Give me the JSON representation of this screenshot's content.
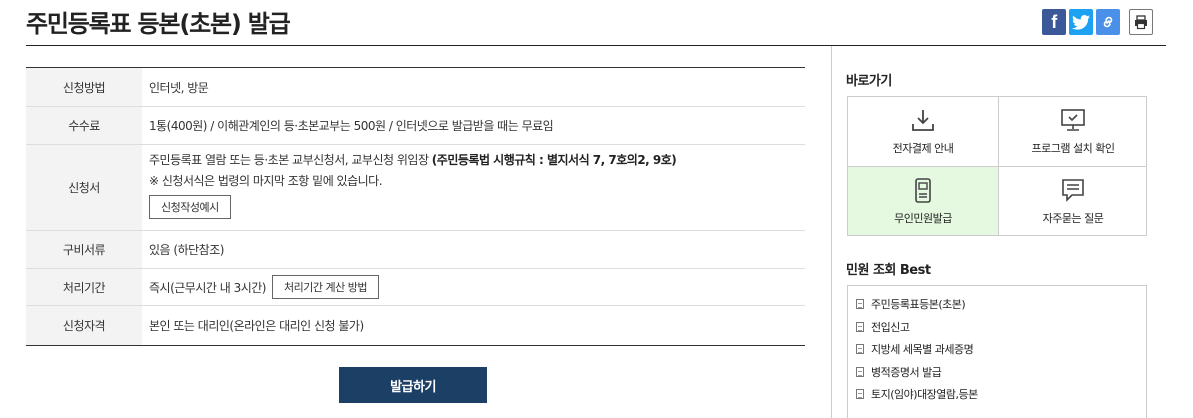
{
  "header": {
    "title": "주민등록표 등본(초본) 발급",
    "share": {
      "facebook_icon": "f"
    }
  },
  "info": {
    "rows": [
      {
        "label": "신청방법",
        "value": "인터넷, 방문"
      },
      {
        "label": "수수료",
        "value": "1통(400원) / 이해관계인의 등·초본교부는 500원 / 인터넷으로 발급받을 때는 무료임"
      },
      {
        "label": "신청서",
        "line1_prefix": "주민등록표 열람 또는 등·초본 교부신청서, 교부신청 위임장 ",
        "line1_bold": "(주민등록법 시행규칙 : 별지서식 7, 7호의2, 9호)",
        "line2": "※ 신청서식은 법령의 마지막 조항 밑에 있습니다.",
        "button": "신청작성예시"
      },
      {
        "label": "구비서류",
        "value": "있음 (하단참조)"
      },
      {
        "label": "처리기간",
        "value": "즉시(근무시간 내 3시간)",
        "button": "처리기간 계산 방법"
      },
      {
        "label": "신청자격",
        "value": "본인 또는 대리인(온라인은 대리인 신청 불가)"
      }
    ]
  },
  "submit_label": "발급하기",
  "sidebar": {
    "quick_title": "바로가기",
    "quick_links": [
      {
        "label": "전자결제 안내",
        "icon": "download-icon"
      },
      {
        "label": "프로그램 설치 확인",
        "icon": "monitor-check-icon"
      },
      {
        "label": "무인민원발급",
        "icon": "kiosk-icon"
      },
      {
        "label": "자주묻는 질문",
        "icon": "chat-icon"
      }
    ],
    "best_title": "민원 조회 Best",
    "best_items": [
      "주민등록표등본(초본)",
      "전입신고",
      "지방세 세목별 과세증명",
      "병적증명서 발급",
      "토지(임야)대장열람,등본"
    ]
  },
  "colors": {
    "primary": "#1c3f66",
    "active_bg": "#e4f9e0",
    "facebook": "#3b5998",
    "twitter": "#1da1f2"
  }
}
